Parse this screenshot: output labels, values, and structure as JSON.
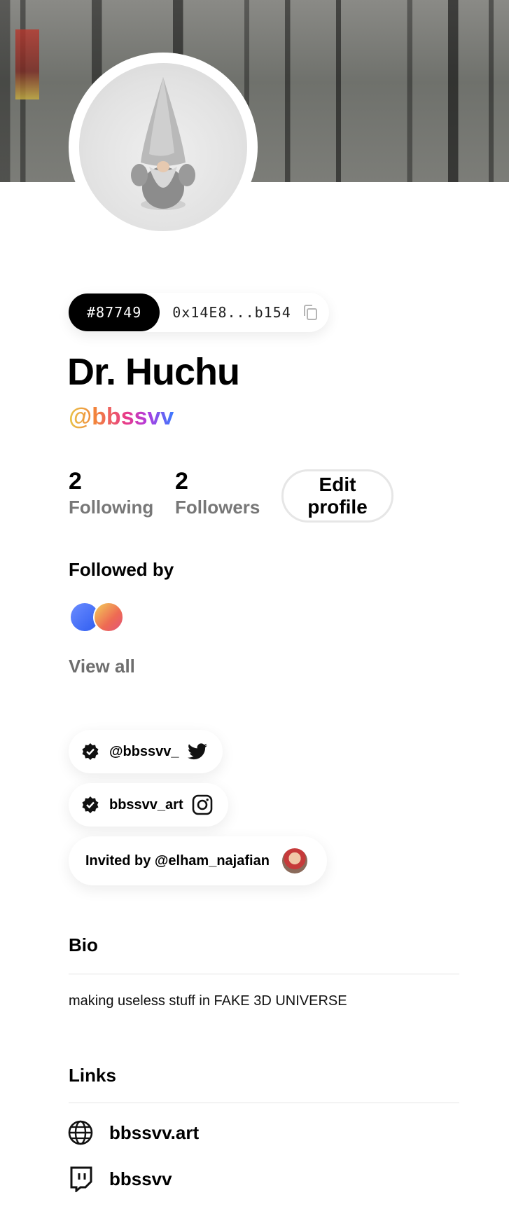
{
  "profile": {
    "token_id": "#87749",
    "address": "0x14E8...b154",
    "name": "Dr. Huchu",
    "handle": "@bbssvv"
  },
  "stats": {
    "following_count": "2",
    "following_label": "Following",
    "followers_count": "2",
    "followers_label": "Followers",
    "edit_label": "Edit profile"
  },
  "followed_by": {
    "heading": "Followed by",
    "view_all": "View all"
  },
  "socials": {
    "twitter": "@bbssvv_",
    "instagram": "bbssvv_art",
    "invited_by": "Invited by @elham_najafian"
  },
  "bio": {
    "heading": "Bio",
    "text": "making useless stuff in FAKE 3D UNIVERSE"
  },
  "links": {
    "heading": "Links",
    "items": [
      {
        "label": "bbssvv.art",
        "icon": "globe-icon"
      },
      {
        "label": "bbssvv",
        "icon": "twitch-icon"
      }
    ]
  },
  "colors": {
    "handle_gradient": [
      "#e8c64a",
      "#f2843a",
      "#e83a8a",
      "#b03ae0",
      "#3a7bff"
    ],
    "token_chip": "#000000",
    "muted_label": "#777777"
  }
}
